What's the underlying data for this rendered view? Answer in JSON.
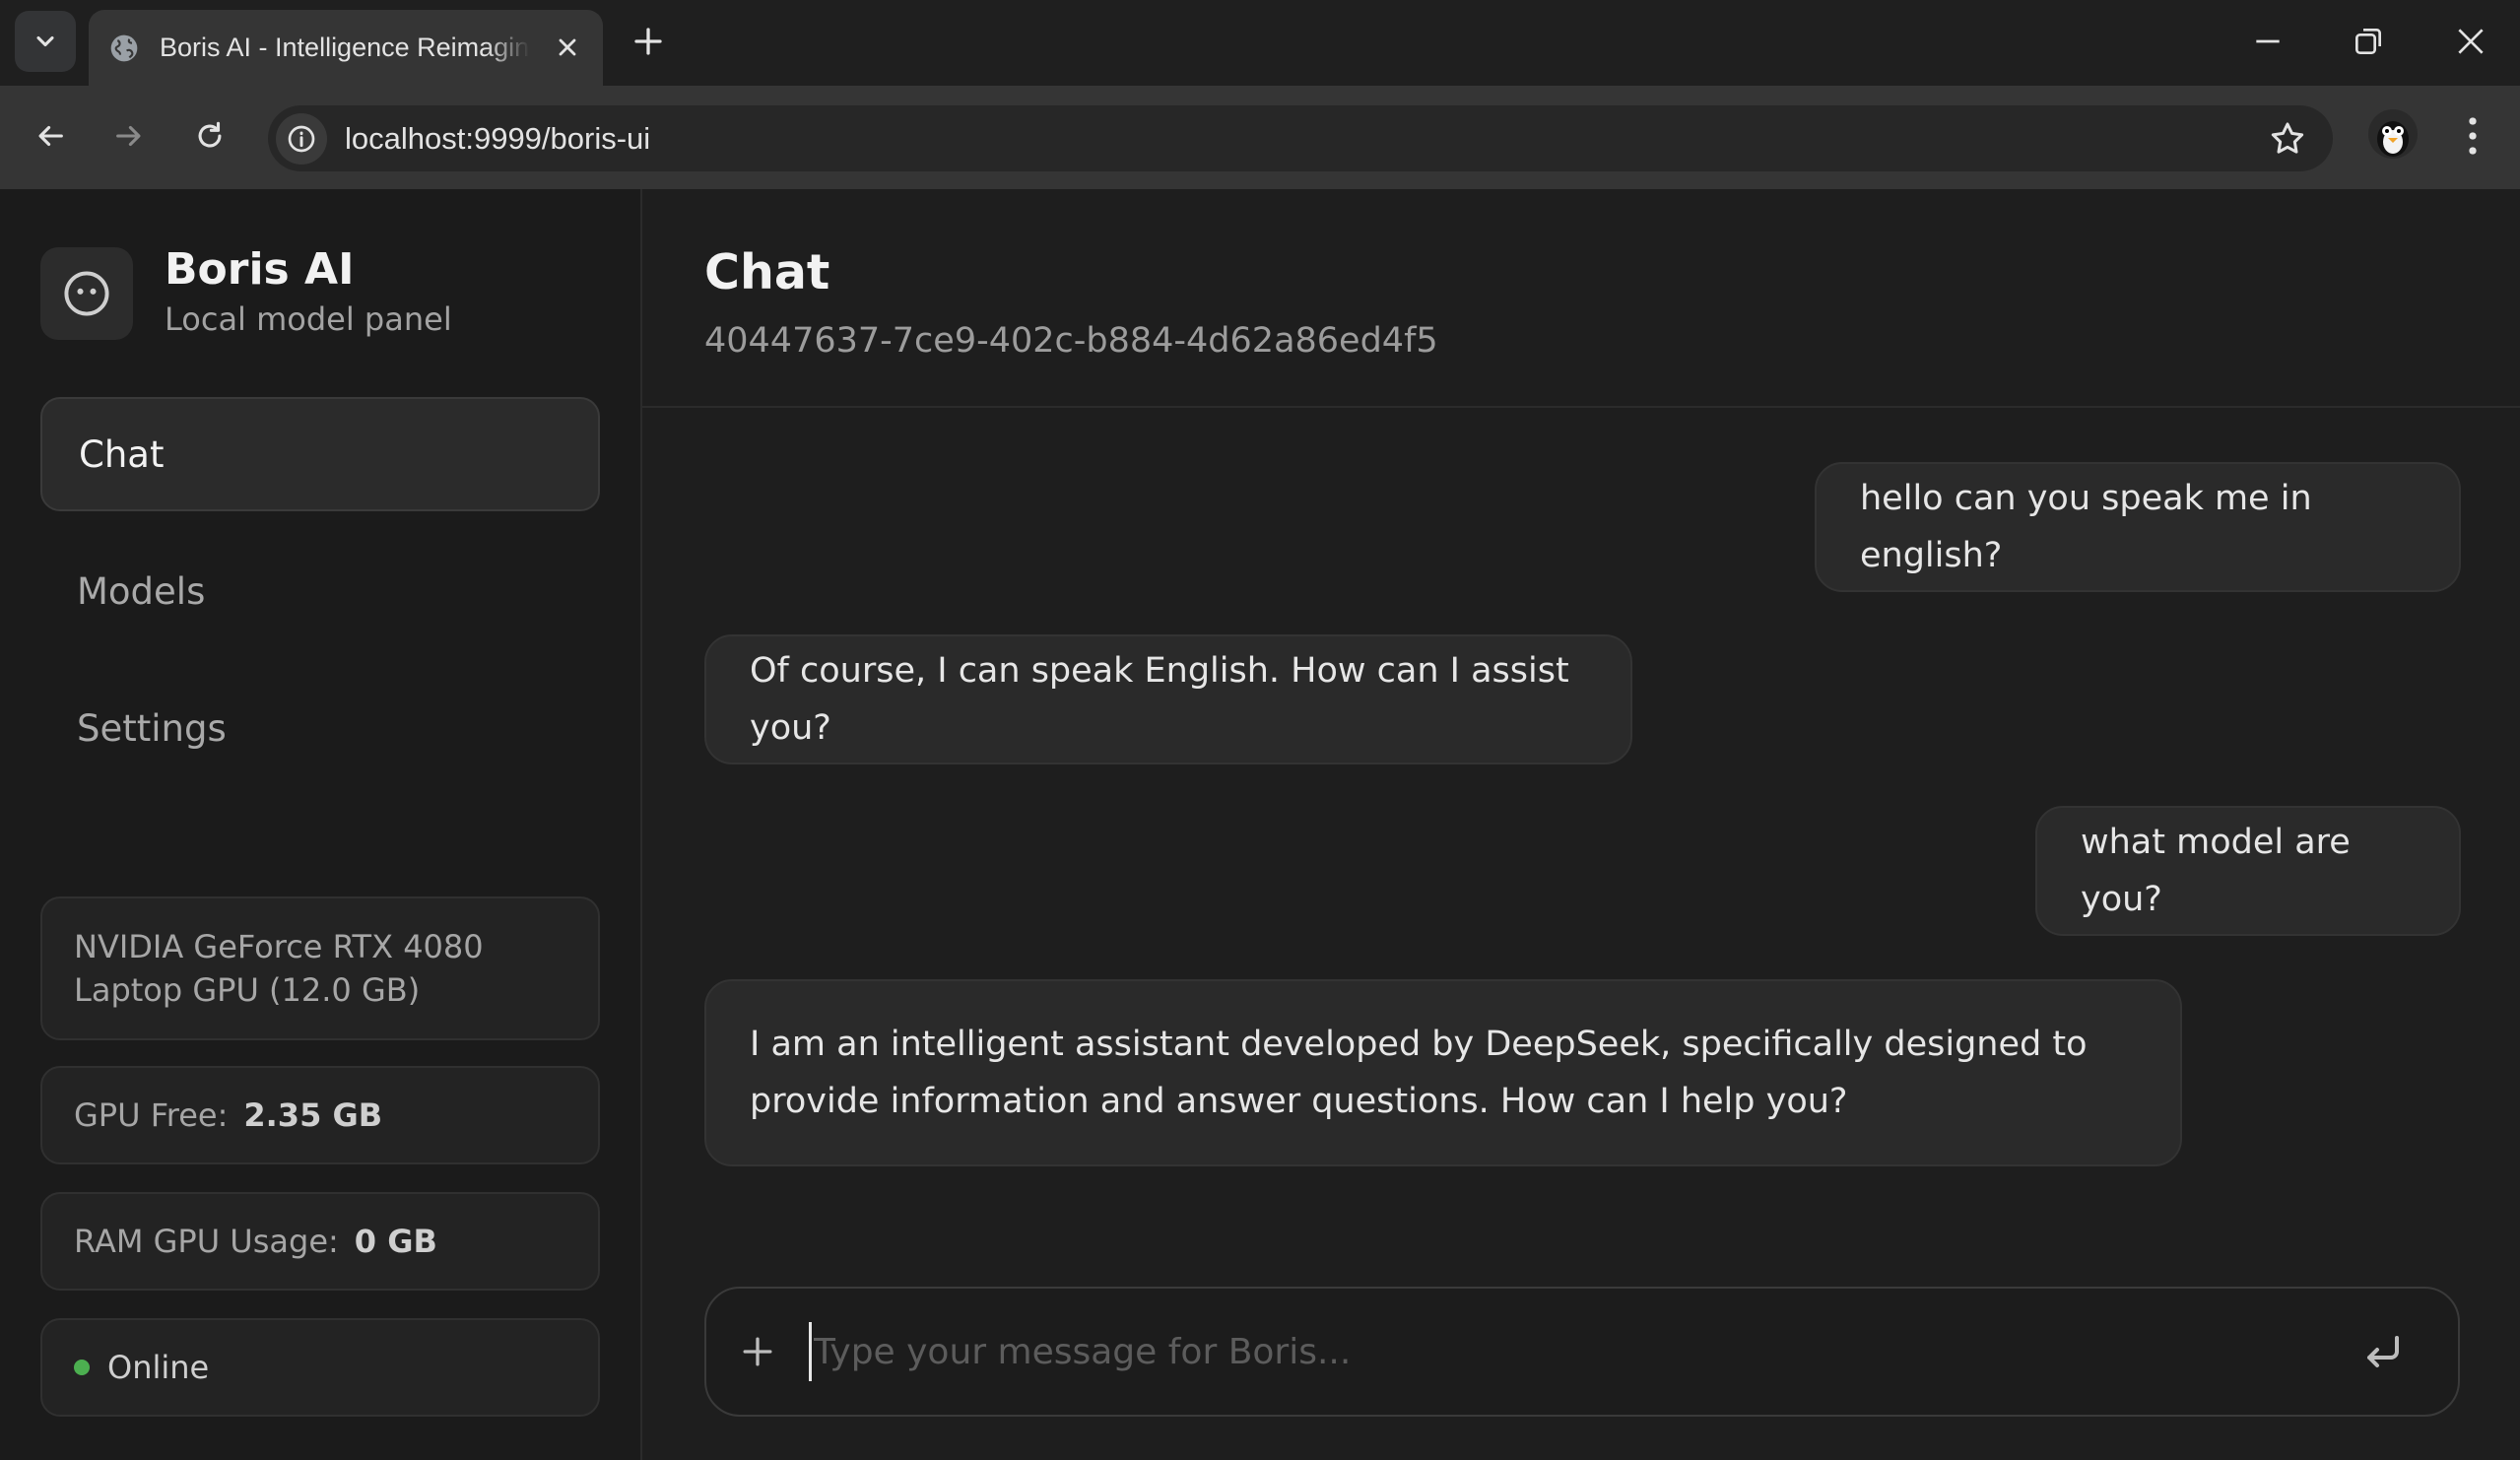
{
  "browser": {
    "tab_title": "Boris AI - Intelligence Reimagined",
    "url": "localhost:9999/boris-ui"
  },
  "sidebar": {
    "brand_name": "Boris AI",
    "brand_subtitle": "Local model panel",
    "nav": [
      {
        "label": "Chat",
        "active": true
      },
      {
        "label": "Models",
        "active": false
      },
      {
        "label": "Settings",
        "active": false
      }
    ],
    "gpu_name": "NVIDIA GeForce RTX 4080 Laptop GPU (12.0 GB)",
    "gpu_free_label": "GPU Free:",
    "gpu_free_value": "2.35 GB",
    "ram_gpu_label": "RAM GPU Usage:",
    "ram_gpu_value": "0 GB",
    "status": "Online",
    "status_color": "#4caf50"
  },
  "chat": {
    "title": "Chat",
    "session_id": "40447637-7ce9-402c-b884-4d62a86ed4f5",
    "messages": [
      {
        "role": "user",
        "text": "hello can you speak me in english?"
      },
      {
        "role": "assistant",
        "text": "Of course, I can speak English. How can I assist you?"
      },
      {
        "role": "user",
        "text": "what model are you?"
      },
      {
        "role": "assistant",
        "text": "I am an intelligent assistant developed by DeepSeek, specifically designed to provide information and answer questions. How can I help you?"
      }
    ],
    "input_placeholder": "Type your message for Boris..."
  }
}
